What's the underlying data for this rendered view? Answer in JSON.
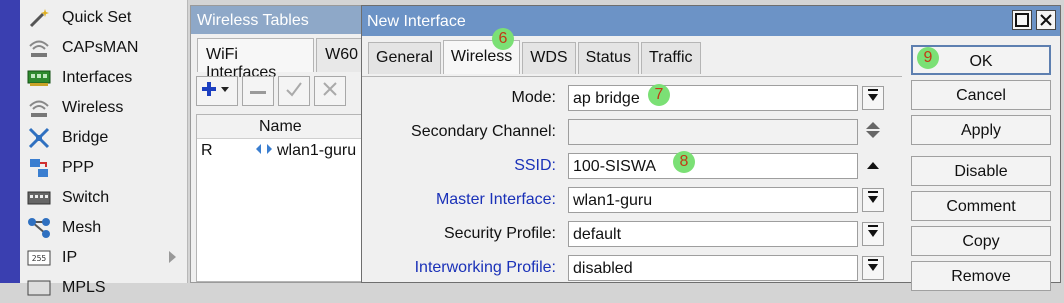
{
  "sidebar": {
    "items": [
      {
        "label": "Quick Set",
        "icon": "magic-wand-icon"
      },
      {
        "label": "CAPsMAN",
        "icon": "wireless-signal-icon"
      },
      {
        "label": "Interfaces",
        "icon": "network-card-icon"
      },
      {
        "label": "Wireless",
        "icon": "wireless-signal-icon"
      },
      {
        "label": "Bridge",
        "icon": "bridge-icon"
      },
      {
        "label": "PPP",
        "icon": "ppp-icon"
      },
      {
        "label": "Switch",
        "icon": "switch-icon"
      },
      {
        "label": "Mesh",
        "icon": "mesh-icon"
      },
      {
        "label": "IP",
        "icon": "ip-icon"
      },
      {
        "label": "MPLS",
        "icon": "mpls-icon"
      }
    ]
  },
  "wireless_tables": {
    "title": "Wireless Tables",
    "tabs": [
      "WiFi Interfaces",
      "W60"
    ],
    "columns": [
      "",
      "Name"
    ],
    "row": {
      "flag": "R",
      "name": "wlan1-guru"
    }
  },
  "dialog": {
    "title": "New Interface",
    "tabs": [
      {
        "label": "General",
        "active": false
      },
      {
        "label": "Wireless",
        "active": true
      },
      {
        "label": "WDS",
        "active": false
      },
      {
        "label": "Status",
        "active": false
      },
      {
        "label": "Traffic",
        "active": false
      }
    ],
    "fields": [
      {
        "label": "Mode:",
        "value": "ap bridge",
        "blue": false
      },
      {
        "label": "Secondary Channel:",
        "value": "",
        "blue": false
      },
      {
        "label": "SSID:",
        "value": "100-SISWA",
        "blue": true
      },
      {
        "label": "Master Interface:",
        "value": "wlan1-guru",
        "blue": true
      },
      {
        "label": "Security Profile:",
        "value": "default",
        "blue": false
      },
      {
        "label": "Interworking Profile:",
        "value": "disabled",
        "blue": true
      }
    ],
    "buttons": [
      "OK",
      "Cancel",
      "Apply",
      "Disable",
      "Comment",
      "Copy",
      "Remove"
    ]
  },
  "markers": {
    "tab": "6",
    "mode": "7",
    "ssid": "8",
    "ok": "9"
  },
  "colors": {
    "accent_strip": "#3a3fb0",
    "title_bar": "#6c93c6",
    "link_label": "#1a31b8",
    "marker_bg": "#7be075",
    "marker_text": "#c23a16"
  }
}
